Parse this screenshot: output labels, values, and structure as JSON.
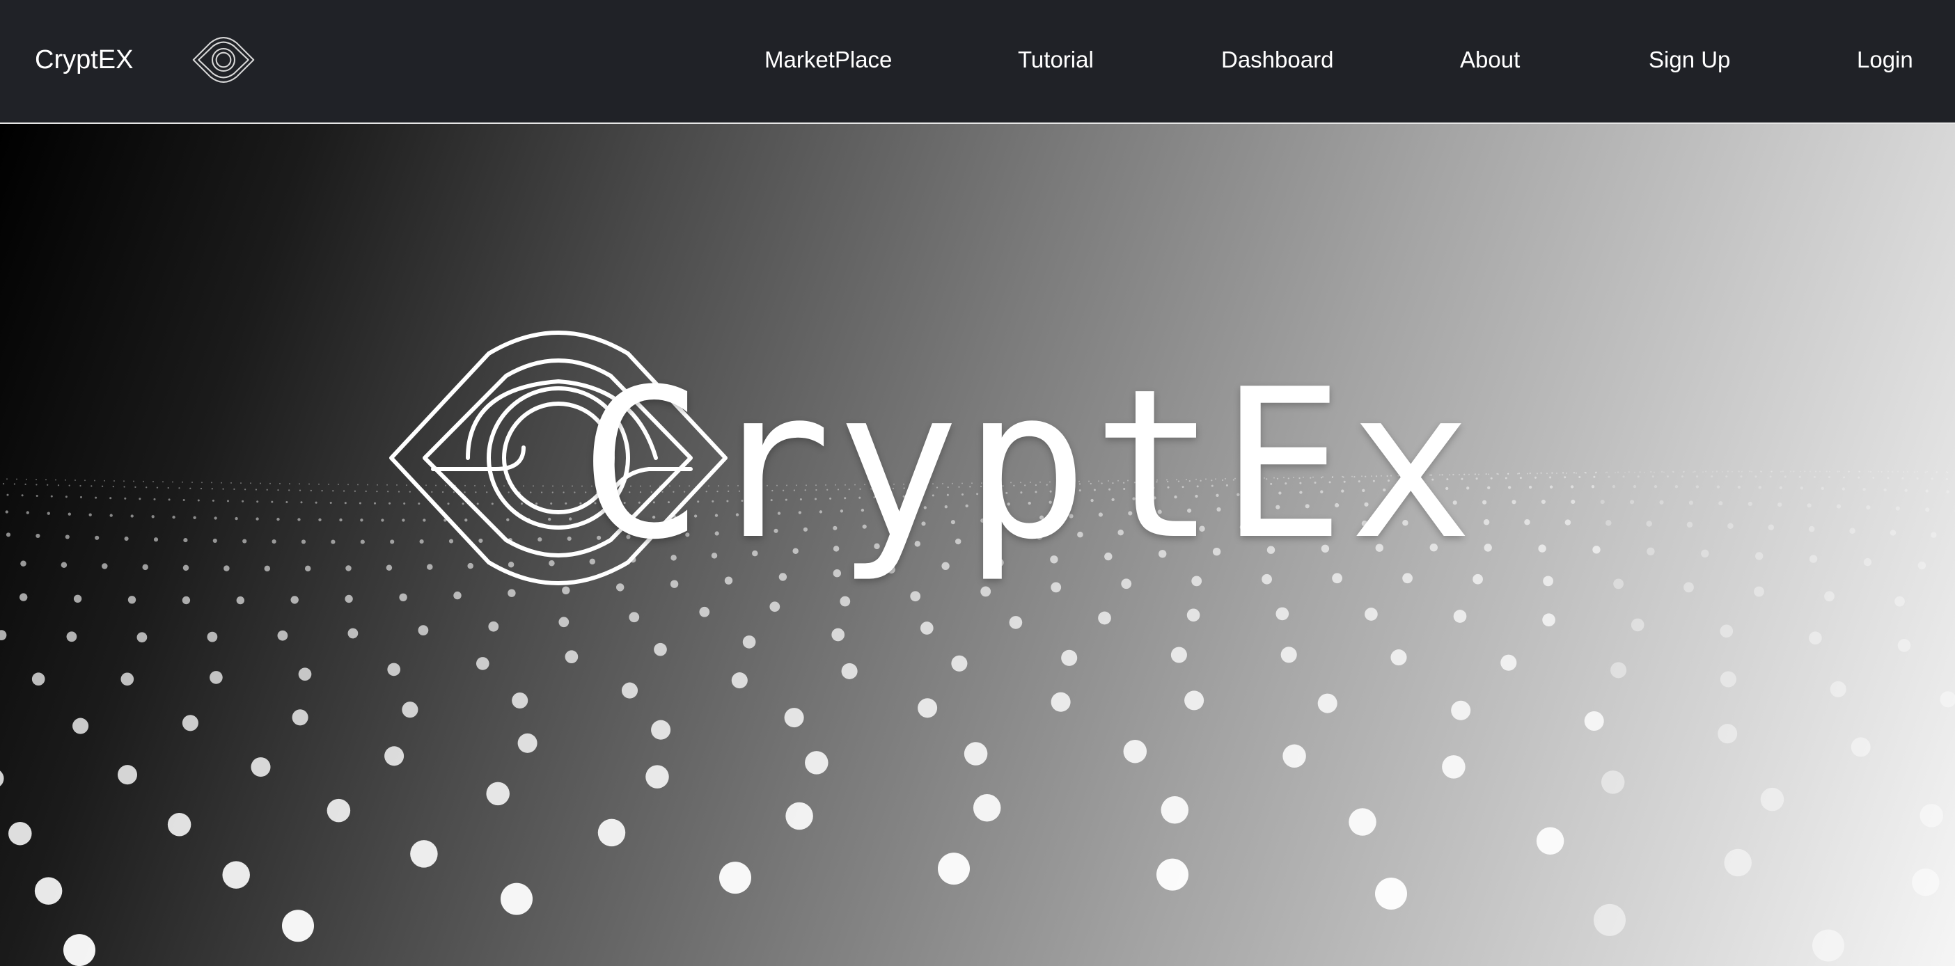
{
  "navbar": {
    "brand": "CryptEX",
    "brand_icon": "eye-logo-icon",
    "links": {
      "marketplace": "MarketPlace",
      "tutorial": "Tutorial",
      "dashboard": "Dashboard",
      "about": "About",
      "signup": "Sign Up",
      "login": "Login"
    }
  },
  "hero": {
    "title": "CryptEx",
    "logo_icon": "eye-logo-icon",
    "background": "particle-wave-gradient"
  },
  "colors": {
    "navbar_bg": "#202227",
    "text": "#ffffff",
    "gradient_start": "#000000",
    "gradient_end": "#f5f5f5"
  }
}
